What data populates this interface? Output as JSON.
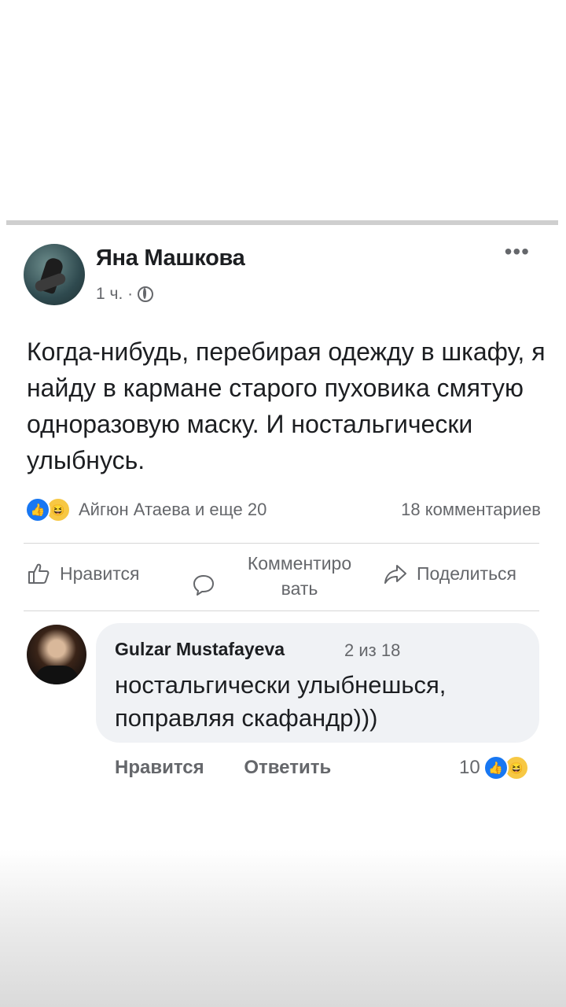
{
  "post": {
    "author": "Яна Машкова",
    "time": "1 ч. ·",
    "text": "Когда-нибудь, перебирая одежду в шкафу, я найду в кармане старого пуховика смятую одноразовую маску. И ностальгически улыбнусь.",
    "reactions_text": "Айгюн Атаева и еще 20",
    "comments_count": "18 комментариев"
  },
  "actions": {
    "like": "Нравится",
    "comment_line1": "Комментиро",
    "comment_line2": "вать",
    "share": "Поделиться"
  },
  "comment": {
    "author": "Gulzar Mustafayeva",
    "position": "2 из 18",
    "text": "ностальгически улыбнешься, поправляя скафандр)))",
    "like": "Нравится",
    "reply": "Ответить",
    "reactions_count": "10"
  },
  "icons": {
    "like_reaction": "thumbs-up-icon",
    "haha_reaction": "laughing-face-icon",
    "privacy": "globe-icon",
    "menu": "more-horizontal-icon"
  },
  "colors": {
    "accent": "#1877f2",
    "haha": "#f7c844",
    "secondary_text": "#65676b",
    "bubble": "#f0f2f5"
  }
}
